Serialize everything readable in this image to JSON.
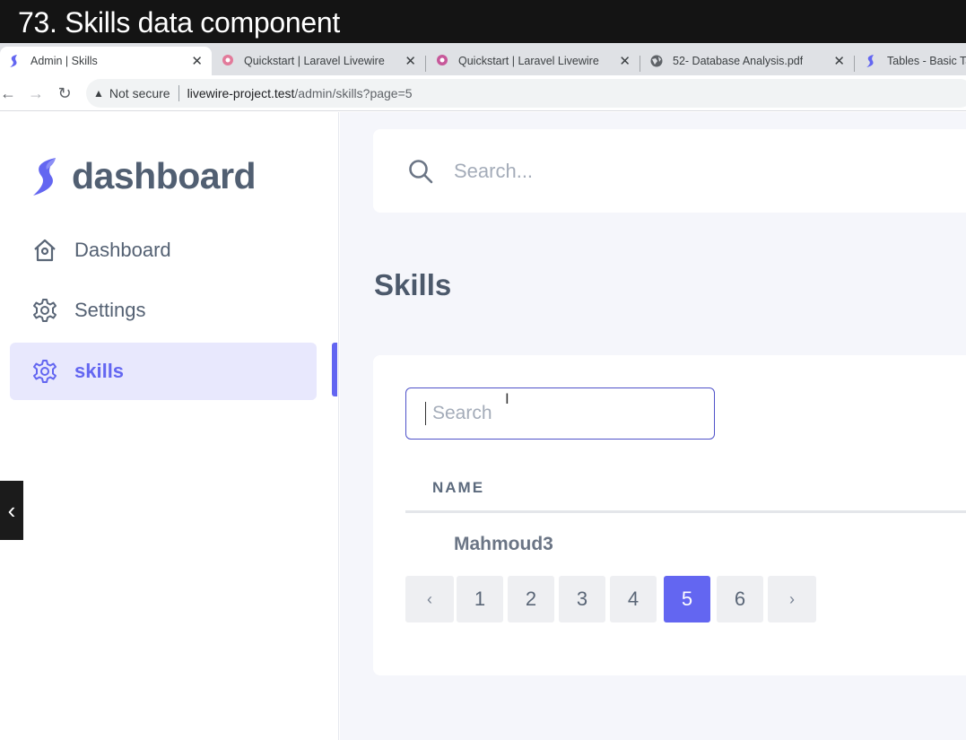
{
  "caption": {
    "text": "73. Skills data component"
  },
  "browser": {
    "tabs": [
      {
        "title": "Admin | Skills",
        "icon": "livewire-s-icon",
        "active": true
      },
      {
        "title": "Quickstart | Laravel Livewire",
        "icon": "livewire-eye-icon",
        "active": false
      },
      {
        "title": "Quickstart | Laravel Livewire",
        "icon": "livewire-eye-icon",
        "active": false
      },
      {
        "title": "52- Database Analysis.pdf",
        "icon": "globe-icon",
        "active": false
      },
      {
        "title": "Tables - Basic Tab",
        "icon": "livewire-s-icon",
        "active": false
      }
    ],
    "close_glyph": "✕",
    "address": {
      "warning_glyph": "▲",
      "security_label": "Not secure",
      "url_host": "livewire-project.test",
      "url_path": "/admin/skills?page=5"
    },
    "nav_glyphs": {
      "back": "←",
      "forward": "→",
      "reload": "↻"
    }
  },
  "sidebar": {
    "brand": "dashboard",
    "items": [
      {
        "label": "Dashboard",
        "icon": "home-icon",
        "active": false
      },
      {
        "label": "Settings",
        "icon": "gear-icon",
        "active": false
      },
      {
        "label": "skills",
        "icon": "gear-icon",
        "active": true
      }
    ],
    "collapse_glyph": "‹"
  },
  "header": {
    "search_placeholder": "Search..."
  },
  "main": {
    "title": "Skills",
    "filter_placeholder": "Search",
    "cursor_glyph": "I",
    "table": {
      "columns": [
        "NAME"
      ],
      "rows": [
        {
          "name": "Mahmoud3"
        }
      ]
    },
    "pagination": {
      "prev": "‹",
      "pages": [
        "1",
        "2",
        "3",
        "4",
        "5",
        "6"
      ],
      "next": "›",
      "current": "5"
    }
  },
  "colors": {
    "accent": "#6366f1",
    "active_bg": "#e8e8fd",
    "main_bg": "#f5f6fb"
  }
}
